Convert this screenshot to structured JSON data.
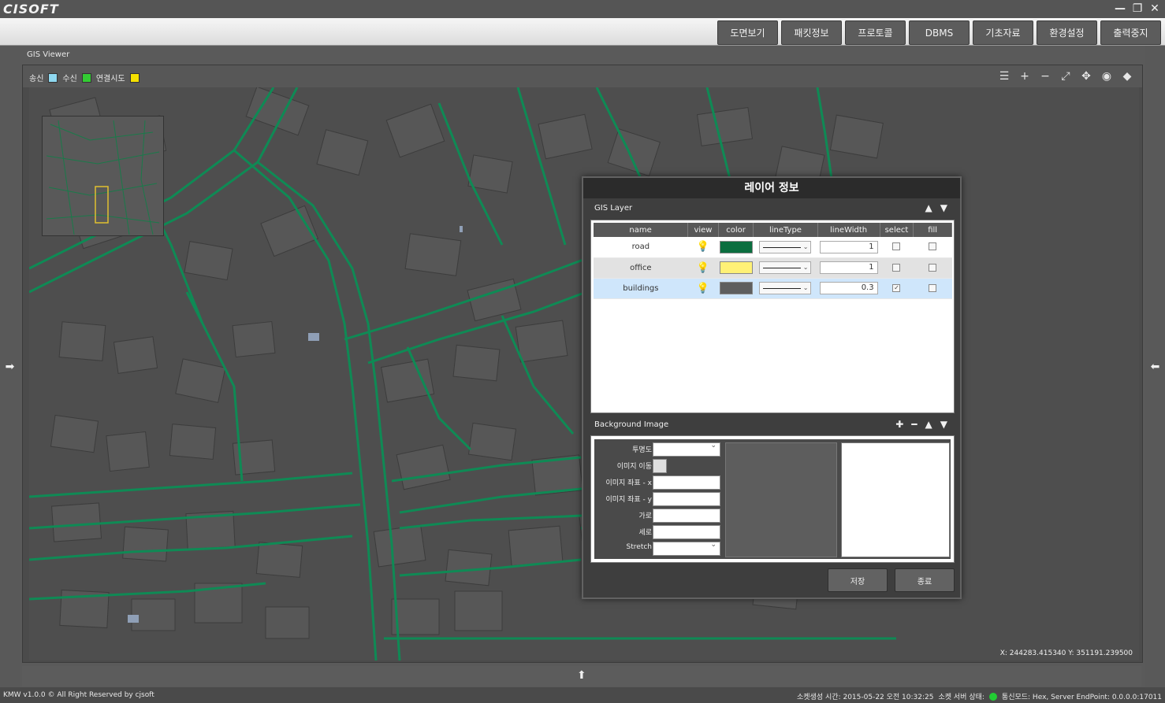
{
  "app": {
    "logo": "CISOFT",
    "window_controls": [
      "—",
      "❐",
      "✕"
    ]
  },
  "menu": [
    {
      "label": "도면보기",
      "name": "menu-drawing-view"
    },
    {
      "label": "패킷정보",
      "name": "menu-packet-info"
    },
    {
      "label": "프로토콜",
      "name": "menu-protocol"
    },
    {
      "label": "DBMS",
      "name": "menu-dbms"
    },
    {
      "label": "기초자료",
      "name": "menu-base-data"
    },
    {
      "label": "환경설정",
      "name": "menu-settings"
    },
    {
      "label": "출력중지",
      "name": "menu-stop-output"
    }
  ],
  "viewer": {
    "title": "GIS Viewer",
    "legend": [
      {
        "label": "송신",
        "color": "#8fd8f0"
      },
      {
        "label": "수신",
        "color": "#33cc33"
      },
      {
        "label": "연결시도",
        "color": "#f5e000"
      }
    ],
    "coords": "X: 244283.415340   Y: 351191.239500"
  },
  "dialog": {
    "title": "레이어 정보",
    "gis_layer_label": "GIS Layer",
    "columns": [
      "name",
      "view",
      "color",
      "lineType",
      "lineWidth",
      "select",
      "fill"
    ],
    "layers": [
      {
        "name": "road",
        "color": "#0b6e3f",
        "lineWidth": "1",
        "select": "",
        "fill": ""
      },
      {
        "name": "office",
        "color": "#fff176",
        "lineWidth": "1",
        "select": "",
        "fill": ""
      },
      {
        "name": "buildings",
        "color": "#5e5e5e",
        "lineWidth": "0.3",
        "select": "✓",
        "fill": ""
      }
    ],
    "background_label": "Background Image",
    "bg_fields": [
      {
        "label": "투명도",
        "type": "select"
      },
      {
        "label": "이미지 이동",
        "type": "toggle"
      },
      {
        "label": "이미지 좌표 - x",
        "type": "input"
      },
      {
        "label": "이미지 좌표 - y",
        "type": "input"
      },
      {
        "label": "가로",
        "type": "input"
      },
      {
        "label": "세로",
        "type": "input"
      },
      {
        "label": "Stretch",
        "type": "select"
      }
    ],
    "save_label": "저장",
    "close_label": "종료"
  },
  "status": {
    "left": "KMW v1.0.0 © All Right Reserved by cjsoft",
    "socket_time": "소켓생성 시간: 2015-05-22 오전 10:32:25",
    "server_state": "소켓 서버 상태:",
    "comm_mode": "통신모드: Hex, Server EndPoint: 0.0.0.0:17011"
  }
}
